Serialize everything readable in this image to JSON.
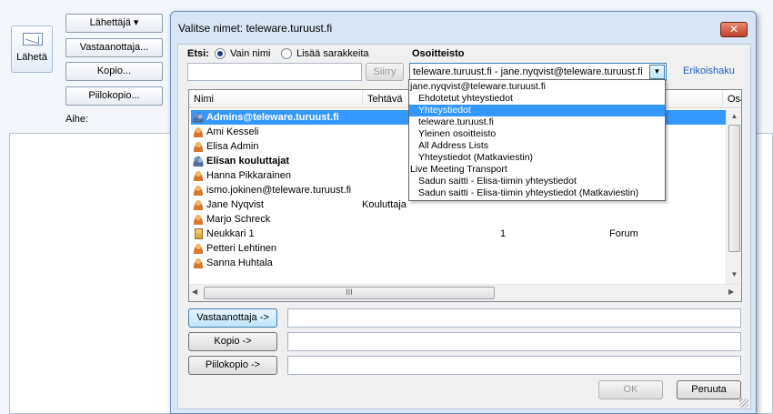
{
  "background": {
    "send_label": "Lähetä",
    "from_label": "Lähettäjä ▾",
    "to_label": "Vastaanottaja...",
    "cc_label": "Kopio...",
    "bcc_label": "Piilokopio...",
    "subject_label": "Aihe:"
  },
  "dialog": {
    "title": "Valitse nimet: teleware.turuust.fi",
    "close_glyph": "✕",
    "search_label": "Etsi:",
    "radio_name_only": "Vain nimi",
    "radio_more_columns": "Lisää sarakkeita",
    "address_book_label": "Osoitteisto",
    "search_value": "",
    "go_label": "Siirry",
    "address_book_value": "teleware.turuust.fi - jane.nyqvist@teleware.turuust.fi",
    "advanced_find": "Erikoishaku",
    "columns": [
      "Nimi",
      "Tehtävä",
      "Osa"
    ],
    "contacts": [
      {
        "name": "Admins@teleware.turuust.fi",
        "type": "group",
        "bold": true,
        "selected": true,
        "title": "",
        "phone": "",
        "office": ""
      },
      {
        "name": "Ami Kesseli",
        "type": "person",
        "bold": false,
        "selected": false,
        "title": "",
        "phone": "",
        "office": ""
      },
      {
        "name": "Elisa Admin",
        "type": "person",
        "bold": false,
        "selected": false,
        "title": "",
        "phone": "",
        "office": ""
      },
      {
        "name": "Elisan kouluttajat",
        "type": "group",
        "bold": true,
        "selected": false,
        "title": "",
        "phone": "",
        "office": ""
      },
      {
        "name": "Hanna Pikkarainen",
        "type": "person",
        "bold": false,
        "selected": false,
        "title": "",
        "phone": "",
        "office": ""
      },
      {
        "name": "ismo.jokinen@teleware.turuust.fi",
        "type": "person",
        "bold": false,
        "selected": false,
        "title": "",
        "phone": "",
        "office": ""
      },
      {
        "name": "Jane Nyqvist",
        "type": "person",
        "bold": false,
        "selected": false,
        "title": "Kouluttaja",
        "phone": "",
        "office": ""
      },
      {
        "name": "Marjo Schreck",
        "type": "person",
        "bold": false,
        "selected": false,
        "title": "",
        "phone": "",
        "office": ""
      },
      {
        "name": "Neukkari 1",
        "type": "room",
        "bold": false,
        "selected": false,
        "title": "",
        "phone": "1",
        "office": "Forum"
      },
      {
        "name": "Petteri Lehtinen",
        "type": "person",
        "bold": false,
        "selected": false,
        "title": "",
        "phone": "",
        "office": ""
      },
      {
        "name": "Sanna Huhtala",
        "type": "person",
        "bold": false,
        "selected": false,
        "title": "",
        "phone": "",
        "office": ""
      }
    ],
    "hscroll_grip": "III",
    "to_button": "Vastaanottaja ->",
    "cc_button": "Kopio ->",
    "bcc_button": "Piilokopio ->",
    "ok_button": "OK",
    "cancel_button": "Peruuta"
  },
  "dropdown": {
    "items": [
      {
        "label": "jane.nyqvist@teleware.turuust.fi",
        "indent": 0,
        "selected": false
      },
      {
        "label": "Ehdotetut yhteystiedot",
        "indent": 1,
        "selected": false
      },
      {
        "label": "Yhteystiedot",
        "indent": 1,
        "selected": true
      },
      {
        "label": "teleware.turuust.fi",
        "indent": 1,
        "selected": false
      },
      {
        "label": "Yleinen osoitteisto",
        "indent": 1,
        "selected": false
      },
      {
        "label": "All Address Lists",
        "indent": 1,
        "selected": false
      },
      {
        "label": "Yhteystiedot (Matkaviestin)",
        "indent": 1,
        "selected": false
      },
      {
        "label": "Live Meeting Transport",
        "indent": 0,
        "selected": false
      },
      {
        "label": "Sadun saitti - Elisa-tiimin yhteystiedot",
        "indent": 1,
        "selected": false
      },
      {
        "label": "Sadun saitti - Elisa-tiimin yhteystiedot (Matkaviestin)",
        "indent": 1,
        "selected": false
      }
    ]
  },
  "colors": {
    "selection": "#3399ff",
    "link": "#1f5fbf",
    "close": "#c0442a"
  }
}
